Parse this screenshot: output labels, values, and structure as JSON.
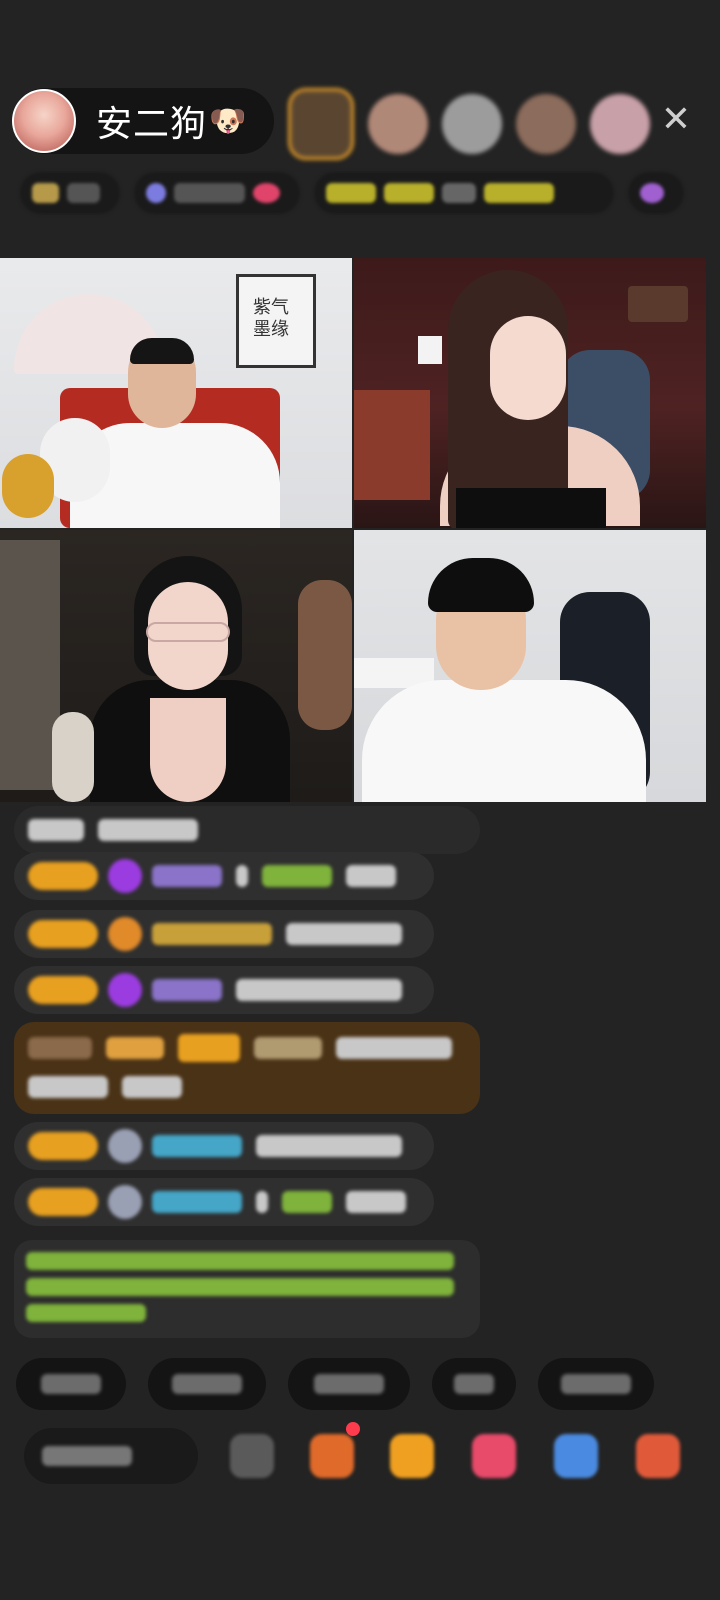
{
  "header": {
    "host_name": "安二狗",
    "host_emoji": "🐶",
    "close_glyph": "✕"
  },
  "colors": {
    "background": "#232323",
    "pill_dark": "#141414",
    "level_badge": "#e8a020",
    "gift_bubble": "#4a3216"
  }
}
